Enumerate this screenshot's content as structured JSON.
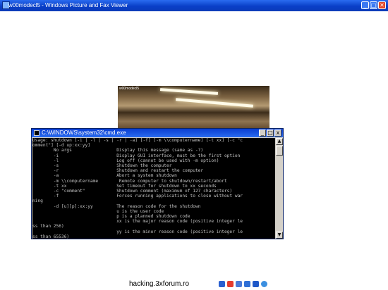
{
  "window": {
    "title": "w00modecl5 - Windows Picture and Fax Viewer",
    "minimize_label": "_",
    "maximize_label": "□",
    "close_label": "✕"
  },
  "photo": {
    "overlay_text": "w00modecl5"
  },
  "cmd": {
    "title": "C:\\WINDOWS\\system32\\cmd.exe",
    "minimize_label": "_",
    "maximize_label": "□",
    "close_label": "x",
    "lines": [
      "Usage: shutdown [-i | -l | -s | -r | -a] [-f] [-m \\\\computername] [-t xx] [-c \"c",
      "omment\"] [-d up:xx:yy]",
      "",
      "        No args                 Display this message (same as -?)",
      "        -i                      Display GUI interface, must be the first option",
      "        -l                      Log off (cannot be used with -m option)",
      "        -s                      Shutdown the computer",
      "        -r                      Shutdown and restart the computer",
      "        -a                      Abort a system shutdown",
      "        -m \\\\computername        Remote computer to shutdown/restart/abort",
      "        -t xx                   Set timeout for shutdown to xx seconds",
      "        -c \"comment\"            Shutdown comment (maximum of 127 characters)",
      "        -f                      Forces running applications to close without war",
      "ning",
      "        -d [u][p]:xx:yy         The reason code for the shutdown",
      "                                u is the user code",
      "                                p is a planned shutdown code",
      "                                xx is the major reason code (positive integer le",
      "ss than 256)",
      "                                yy is the minor reason code (positive integer le",
      "ss than 65536)",
      ""
    ]
  },
  "bottom": {
    "site": "hacking.3xforum.ro"
  }
}
